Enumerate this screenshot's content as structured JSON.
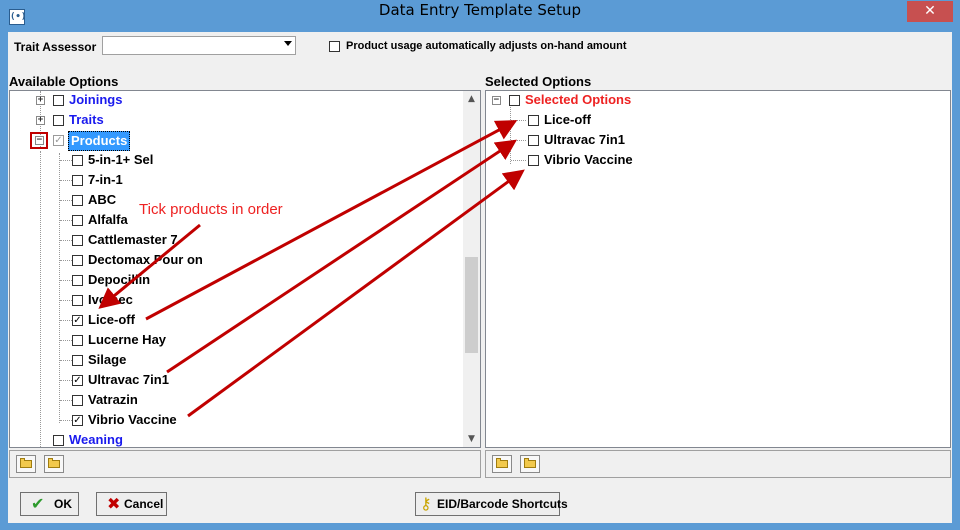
{
  "window": {
    "title": "Data Entry Template Setup",
    "close_glyph": "✕",
    "icon_glyph": "(•)"
  },
  "header": {
    "trait_assessor_label": "Trait Assessor",
    "trait_assessor_value": "",
    "product_usage_label": "Product usage automatically adjusts on-hand amount",
    "product_usage_checked": false
  },
  "available": {
    "heading": "Available Options",
    "groups": {
      "joinings": "Joinings",
      "traits": "Traits",
      "products": "Products",
      "weaning": "Weaning"
    },
    "products": [
      {
        "label": "5-in-1+ Sel",
        "checked": false
      },
      {
        "label": "7-in-1",
        "checked": false
      },
      {
        "label": "ABC",
        "checked": false
      },
      {
        "label": "Alfalfa",
        "checked": false
      },
      {
        "label": "Cattlemaster 7",
        "checked": false
      },
      {
        "label": "Dectomax Pour on",
        "checked": false
      },
      {
        "label": "Depocillin",
        "checked": false
      },
      {
        "label": "Ivomec",
        "checked": false
      },
      {
        "label": "Lice-off",
        "checked": true
      },
      {
        "label": "Lucerne Hay",
        "checked": false
      },
      {
        "label": "Silage",
        "checked": false
      },
      {
        "label": "Ultravac 7in1",
        "checked": true
      },
      {
        "label": "Vatrazin",
        "checked": false
      },
      {
        "label": "Vibrio Vaccine",
        "checked": true
      }
    ]
  },
  "selected": {
    "heading": "Selected Options",
    "root": "Selected Options",
    "items": [
      "Lice-off",
      "Ultravac 7in1",
      "Vibrio Vaccine"
    ]
  },
  "annotation": {
    "text": "Tick products in order",
    "color": "#ee2222"
  },
  "buttons": {
    "ok": "OK",
    "cancel": "Cancel",
    "shortcuts": "EID/Barcode Shortcuts"
  },
  "colors": {
    "title_bar": "#5b9bd5",
    "close_button": "#c75050",
    "link_blue": "#1a1aee",
    "annotation_red": "#ee2222",
    "arrow_red": "#c00000"
  }
}
